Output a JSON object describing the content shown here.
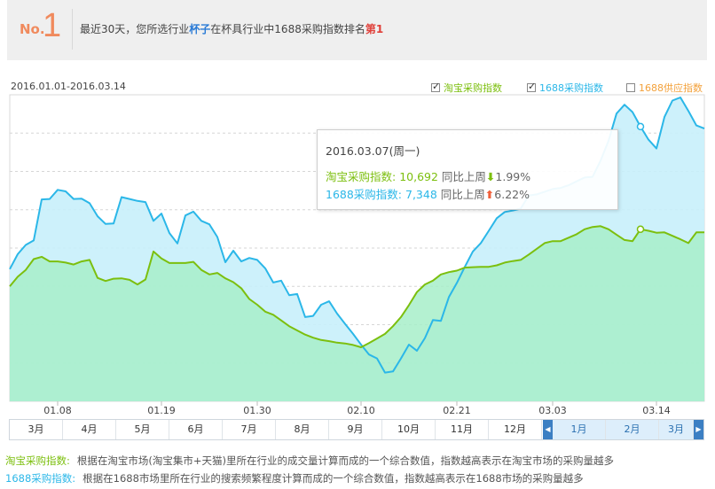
{
  "header": {
    "no_label": "No.",
    "rank_number": "1",
    "msg_prefix": "最近30天，您所选行业",
    "keyword": "杯子",
    "msg_middle": "在杯具行业中1688采购指数排名",
    "rank_text": "第1"
  },
  "date_range": "2016.01.01-2016.03.14",
  "legend": [
    {
      "label": "淘宝采购指数",
      "checked": true,
      "color": "#7cbf0e"
    },
    {
      "label": "1688采购指数",
      "checked": true,
      "color": "#2bb7e8"
    },
    {
      "label": "1688供应指数",
      "checked": false,
      "color": "#f3a13b"
    }
  ],
  "tooltip": {
    "date": "2016.03.07(周一)",
    "row1_label": "淘宝采购指数: ",
    "row1_value": "10,692",
    "row1_cmp": " 同比上周",
    "row1_arrow": "⬇",
    "row1_pct": "1.99%",
    "row2_label": "1688采购指数: ",
    "row2_value": "7,348",
    "row2_cmp": " 同比上周",
    "row2_arrow": "⬆",
    "row2_pct": "6.22%"
  },
  "chart_data": {
    "type": "area",
    "x_ticks": [
      "01.08",
      "01.19",
      "01.30",
      "02.10",
      "02.21",
      "03.03",
      "03.14"
    ],
    "series": [
      {
        "name": "淘宝采购指数",
        "color": "#7cbf0e",
        "values": [
          300,
          325,
          343,
          371,
          377,
          365,
          365,
          362,
          357,
          365,
          369,
          322,
          314,
          320,
          321,
          317,
          305,
          318,
          391,
          373,
          361,
          361,
          361,
          364,
          343,
          331,
          335,
          321,
          311,
          295,
          267,
          252,
          234,
          226,
          211,
          196,
          185,
          174,
          166,
          160,
          157,
          153,
          151,
          147,
          141,
          152,
          164,
          176,
          196,
          220,
          251,
          285,
          305,
          315,
          331,
          337,
          341,
          349,
          350,
          351,
          351,
          355,
          362,
          366,
          369,
          383,
          398,
          413,
          418,
          418,
          427,
          436,
          449,
          455,
          457,
          449,
          435,
          421,
          418,
          449,
          445,
          440,
          441,
          432,
          423,
          413,
          441,
          441
        ]
      },
      {
        "name": "1688采购指数",
        "color": "#2bb7e8",
        "values": [
          345,
          384,
          408,
          420,
          527,
          528,
          552,
          548,
          528,
          529,
          517,
          483,
          463,
          464,
          533,
          528,
          523,
          520,
          471,
          490,
          439,
          412,
          485,
          495,
          471,
          462,
          429,
          363,
          393,
          365,
          374,
          369,
          347,
          310,
          315,
          277,
          280,
          220,
          223,
          252,
          261,
          229,
          202,
          176,
          148,
          122,
          112,
          75,
          78,
          112,
          148,
          132,
          165,
          212,
          210,
          272,
          309,
          351,
          391,
          413,
          445,
          478,
          494,
          498,
          503,
          537,
          540,
          547,
          554,
          557,
          564,
          574,
          584,
          586,
          628,
          680,
          751,
          774,
          755,
          717,
          683,
          660,
          742,
          785,
          793,
          758,
          720,
          712
        ]
      }
    ],
    "ylim": [
      0,
      800
    ],
    "grid": true,
    "highlight_index": 79
  },
  "months": [
    "3月",
    "4月",
    "5月",
    "6月",
    "7月",
    "8月",
    "9月",
    "10月",
    "11月",
    "12月",
    "1月",
    "2月",
    "3月"
  ],
  "months_selected": [
    10,
    11,
    12
  ],
  "notes": [
    {
      "label": "淘宝采购指数:",
      "text": "根据在淘宝市场(淘宝集市+天猫)里所在行业的成交量计算而成的一个综合数值，指数越高表示在淘宝市场的采购量越多"
    },
    {
      "label": "1688采购指数:",
      "text": "根据在1688市场里所在行业的搜索频繁程度计算而成的一个综合数值，指数越高表示在1688市场的采购量越多"
    }
  ]
}
